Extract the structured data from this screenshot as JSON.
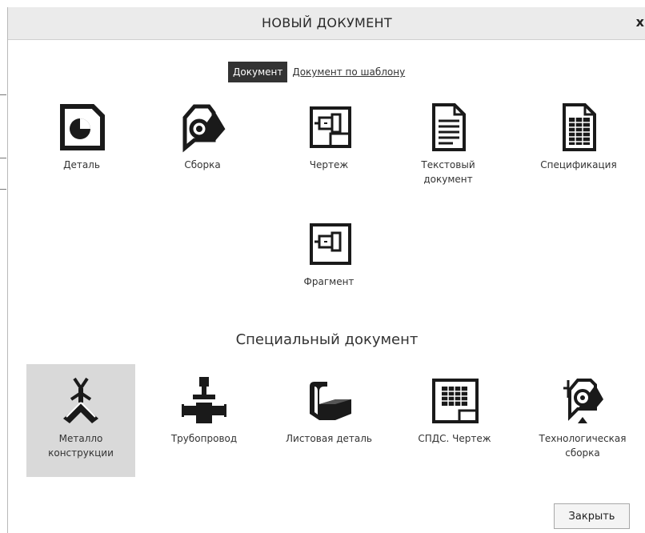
{
  "window": {
    "title": "НОВЫЙ ДОКУМЕНТ",
    "close_glyph": "x"
  },
  "tabs": {
    "active": "Документ",
    "template_link": "Документ по шаблону"
  },
  "documents": [
    {
      "label": "Деталь",
      "icon": "part-icon"
    },
    {
      "label": "Сборка",
      "icon": "assembly-icon"
    },
    {
      "label": "Чертеж",
      "icon": "drawing-icon"
    },
    {
      "label": "Текстовый\nдокумент",
      "icon": "text-document-icon"
    },
    {
      "label": "Спецификация",
      "icon": "specification-icon"
    },
    {
      "label": "Фрагмент",
      "icon": "fragment-icon"
    }
  ],
  "special_section_title": "Специальный документ",
  "special_documents": [
    {
      "label": "Металло\nконструкции",
      "icon": "metal-structures-icon",
      "selected": true
    },
    {
      "label": "Трубопровод",
      "icon": "pipeline-icon",
      "selected": false
    },
    {
      "label": "Листовая деталь",
      "icon": "sheet-part-icon",
      "selected": false
    },
    {
      "label": "СПДС. Чертеж",
      "icon": "spds-drawing-icon",
      "selected": false
    },
    {
      "label": "Технологическая\nсборка",
      "icon": "technological-assembly-icon",
      "selected": false
    }
  ],
  "footer": {
    "close_label": "Закрыть"
  },
  "colors": {
    "titlebar": "#ebebeb",
    "active_tab": "#333333",
    "selection": "#d9d9d9",
    "icon": "#1a1a1a"
  }
}
